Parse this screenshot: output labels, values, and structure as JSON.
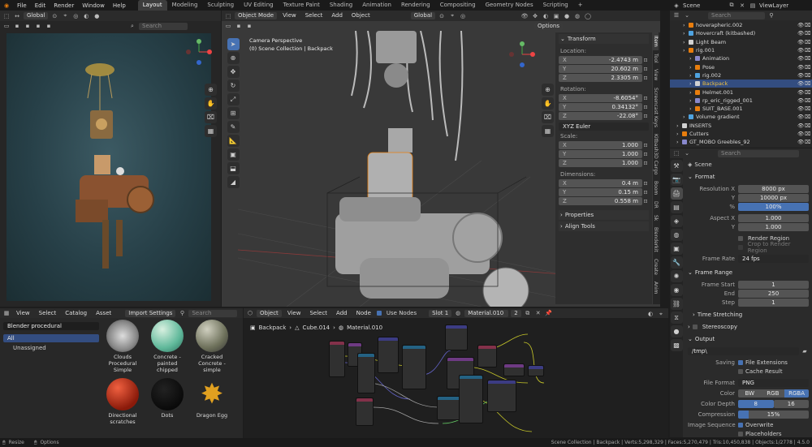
{
  "menubar": {
    "menus": [
      "File",
      "Edit",
      "Render",
      "Window",
      "Help"
    ],
    "workspaces": [
      "Layout",
      "Modeling",
      "Sculpting",
      "UV Editing",
      "Texture Paint",
      "Shading",
      "Animation",
      "Rendering",
      "Compositing",
      "Geometry Nodes",
      "Scripting"
    ],
    "active_workspace": "Layout",
    "scene": "Scene",
    "viewlayer": "ViewLayer"
  },
  "render_view": {
    "orientation": "Global",
    "search_placeholder": "Search"
  },
  "viewport": {
    "mode": "Object Mode",
    "menus": [
      "View",
      "Select",
      "Add",
      "Object"
    ],
    "orientation": "Global",
    "camera_label": "Camera Perspective",
    "collection_label": "(0) Scene Collection | Backpack",
    "options_label": "Options"
  },
  "n_panel": {
    "transform_title": "Transform",
    "location_label": "Location:",
    "location": [
      {
        "axis": "X",
        "value": "-2.4743 m"
      },
      {
        "axis": "Y",
        "value": "20.602 m"
      },
      {
        "axis": "Z",
        "value": "2.3305 m"
      }
    ],
    "rotation_label": "Rotation:",
    "rotation": [
      {
        "axis": "X",
        "value": "-8.6054°"
      },
      {
        "axis": "Y",
        "value": "0.34132°"
      },
      {
        "axis": "Z",
        "value": "-22.08°"
      }
    ],
    "euler": "XYZ Euler",
    "scale_label": "Scale:",
    "scale": [
      {
        "axis": "X",
        "value": "1.000"
      },
      {
        "axis": "Y",
        "value": "1.000"
      },
      {
        "axis": "Z",
        "value": "1.000"
      }
    ],
    "dimensions_label": "Dimensions:",
    "dimensions": [
      {
        "axis": "X",
        "value": "0.4 m"
      },
      {
        "axis": "Y",
        "value": "0.15 m"
      },
      {
        "axis": "Z",
        "value": "0.558 m"
      }
    ],
    "properties": "Properties",
    "align_tools": "Align Tools",
    "tabs": [
      "Item",
      "Tool",
      "View",
      "Screencast Keys",
      "Kitbash3D Cargo",
      "Boom",
      "DR",
      "Sk",
      "Blenderkit",
      "Create",
      "Anim"
    ]
  },
  "outliner": {
    "search_placeholder": "Search",
    "items": [
      {
        "label": "hoverapheric.002",
        "indent": 1,
        "sel": false
      },
      {
        "label": "Hovercraft (kitbashed)",
        "indent": 1,
        "sel": false
      },
      {
        "label": "Light Beam",
        "indent": 1,
        "sel": false
      },
      {
        "label": "rig.001",
        "indent": 1,
        "sel": false
      },
      {
        "label": "Animation",
        "indent": 2,
        "sel": false
      },
      {
        "label": "Pose",
        "indent": 2,
        "sel": false
      },
      {
        "label": "rig.002",
        "indent": 2,
        "sel": false
      },
      {
        "label": "Backpack",
        "indent": 2,
        "sel": true
      },
      {
        "label": "Helmet.001",
        "indent": 2,
        "sel": false
      },
      {
        "label": "rp_eric_rigged_001",
        "indent": 2,
        "sel": false
      },
      {
        "label": "SUIT_BASE.001",
        "indent": 2,
        "sel": false
      },
      {
        "label": "Volume gradient",
        "indent": 1,
        "sel": false
      },
      {
        "label": "INSERTS",
        "indent": 0,
        "sel": false
      },
      {
        "label": "Cutters",
        "indent": 0,
        "sel": false
      },
      {
        "label": "GT_MOBO Greebles_92",
        "indent": 0,
        "sel": false
      }
    ]
  },
  "properties": {
    "search_placeholder": "Search",
    "scene_label": "Scene",
    "format_title": "Format",
    "resolution_x_label": "Resolution X",
    "resolution_x": "8000 px",
    "y_label": "Y",
    "resolution_y": "10000 px",
    "pct_label": "%",
    "resolution_pct": "100%",
    "aspect_x_label": "Aspect X",
    "aspect_x": "1.000",
    "aspect_y": "1.000",
    "render_region": "Render Region",
    "crop_region": "Crop to Render Region",
    "frame_rate_label": "Frame Rate",
    "frame_rate": "24 fps",
    "frame_range_title": "Frame Range",
    "frame_start_label": "Frame Start",
    "frame_start": "1",
    "end_label": "End",
    "frame_end": "250",
    "step_label": "Step",
    "frame_step": "1",
    "time_stretching": "Time Stretching",
    "stereoscopy": "Stereoscopy",
    "output_title": "Output",
    "output_path": "/tmp\\",
    "saving_label": "Saving",
    "file_extensions": "File Extensions",
    "cache_result": "Cache Result",
    "file_format_label": "File Format",
    "file_format": "PNG",
    "color_label": "Color",
    "color_bw": "BW",
    "color_rgb": "RGB",
    "color_rgba": "RGBA",
    "color_depth_label": "Color Depth",
    "depth_8": "8",
    "depth_16": "16",
    "compression_label": "Compression",
    "compression": "15%",
    "image_sequence_label": "Image Sequence",
    "overwrite": "Overwrite",
    "placeholders": "Placeholders"
  },
  "asset_browser": {
    "menus": [
      "View",
      "Select",
      "Catalog",
      "Asset"
    ],
    "import_settings": "Import Settings",
    "search_placeholder": "Search",
    "library": "Blender procedural",
    "catalogs": [
      "All",
      "Unassigned"
    ],
    "assets": [
      {
        "label": "Clouds Procedural Simple",
        "color": "#b8b8b8"
      },
      {
        "label": "Concrete - painted chipped",
        "color": "#5fb89a"
      },
      {
        "label": "Cracked Concrete - simple",
        "color": "#8c8f7a"
      },
      {
        "label": "Directional scratches",
        "color": "#b02a1a"
      },
      {
        "label": "Dots",
        "color": "#050505"
      },
      {
        "label": "Dragon Egg",
        "color": "#e0a020"
      }
    ]
  },
  "node_editor": {
    "type": "Object",
    "menus": [
      "View",
      "Select",
      "Add",
      "Node"
    ],
    "use_nodes": "Use Nodes",
    "slot": "Slot 1",
    "material": "Material.010",
    "users": "2",
    "breadcrumb": [
      "Backpack",
      "Cube.014",
      "Material.010"
    ]
  },
  "statusbar": {
    "left": [
      "Resize",
      "Options"
    ],
    "right": "Scene Collection | Backpack | Verts:5,298,329 | Faces:5,270,479 | Tris:10,450,838 | Objects:1/2778 | 4.5.0"
  }
}
